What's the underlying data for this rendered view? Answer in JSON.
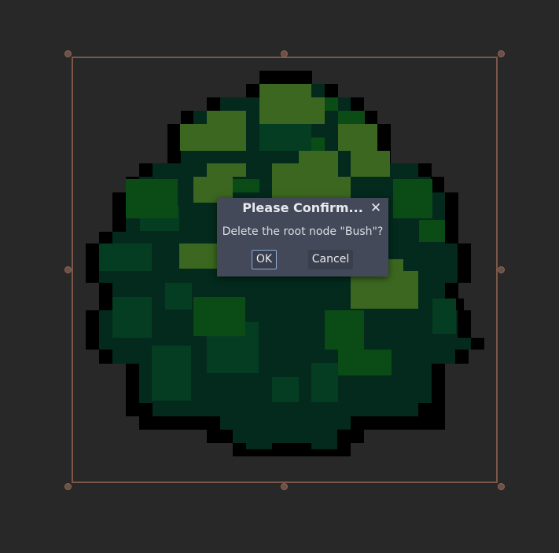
{
  "dialog": {
    "title": "Please Confirm...",
    "close_glyph": "✕",
    "message": "Delete the root node \"Bush\"?",
    "ok_label": "OK",
    "cancel_label": "Cancel"
  },
  "colors": {
    "background": "#282828",
    "selection_frame": "#7b5747",
    "dialog_bg": "#434959",
    "ok_focus_border": "#8ea9d8",
    "sprite_outline": "#000000",
    "sprite_dark": "#032a1c",
    "sprite_mid": "#053d22",
    "sprite_green": "#0b4b16",
    "sprite_light": "#3c6720"
  }
}
